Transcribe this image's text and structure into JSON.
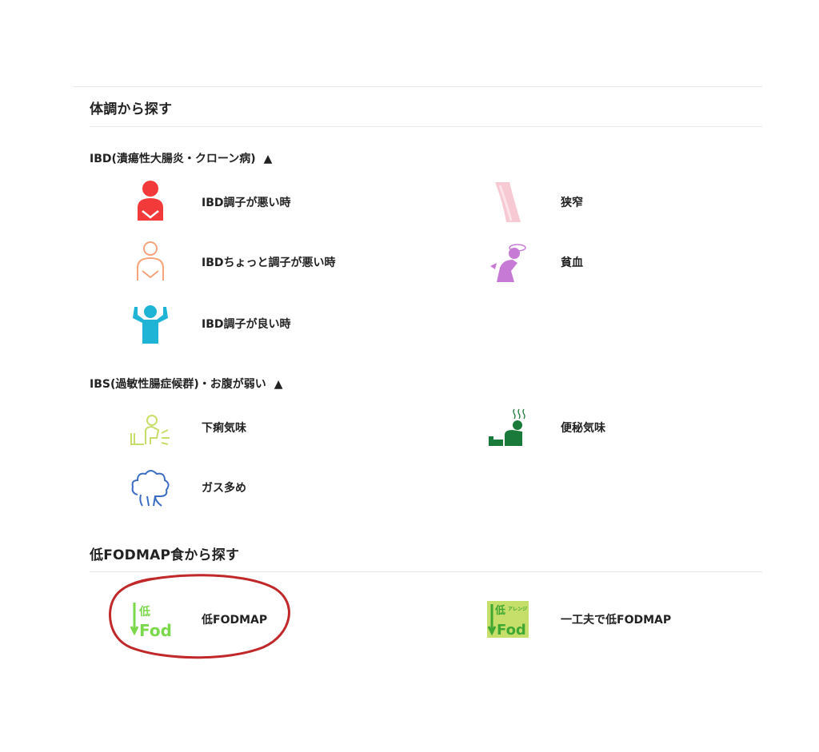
{
  "section1": {
    "heading": "体調から探す",
    "groups": [
      {
        "title": "IBD(潰瘍性大腸炎・クローン病)",
        "toggle": "▲",
        "items": [
          {
            "label": "IBD調子が悪い時",
            "icon": "person-stomach-pain-icon"
          },
          {
            "label": "狭窄",
            "icon": "narrow-intestine-icon"
          },
          {
            "label": "IBDちょっと調子が悪い時",
            "icon": "person-outline-discomfort-icon"
          },
          {
            "label": "貧血",
            "icon": "person-anemia-dizzy-icon"
          },
          {
            "label": "IBD調子が良い時",
            "icon": "person-arms-up-icon"
          }
        ]
      },
      {
        "title": "IBS(過敏性腸症候群)・お腹が弱い",
        "toggle": "▲",
        "items": [
          {
            "label": "下痢気味",
            "icon": "person-toilet-diarrhea-icon"
          },
          {
            "label": "便秘気味",
            "icon": "person-toilet-constipation-icon"
          },
          {
            "label": "ガス多め",
            "icon": "gas-cloud-icon"
          }
        ]
      }
    ]
  },
  "section2": {
    "heading": "低FODMAP食から探す",
    "items": [
      {
        "label": "低FODMAP",
        "icon": "low-fod-icon",
        "icon_text": "低",
        "icon_text2": "Fod"
      },
      {
        "label": "一工夫で低FODMAP",
        "icon": "low-fod-arrange-icon",
        "icon_text": "低",
        "icon_text_small": "アレンジ",
        "icon_text2": "Fod"
      }
    ]
  },
  "colors": {
    "red": "#f23a3a",
    "peach": "#f5a37a",
    "cyan": "#1fb3d6",
    "pink": "#f6c9d3",
    "purple": "#c779d6",
    "lime": "#c6de6a",
    "darkgreen": "#1a7a3a",
    "blue": "#3b6cc4",
    "fodgreen": "#7bd84a",
    "annotation": "#c0282a"
  }
}
